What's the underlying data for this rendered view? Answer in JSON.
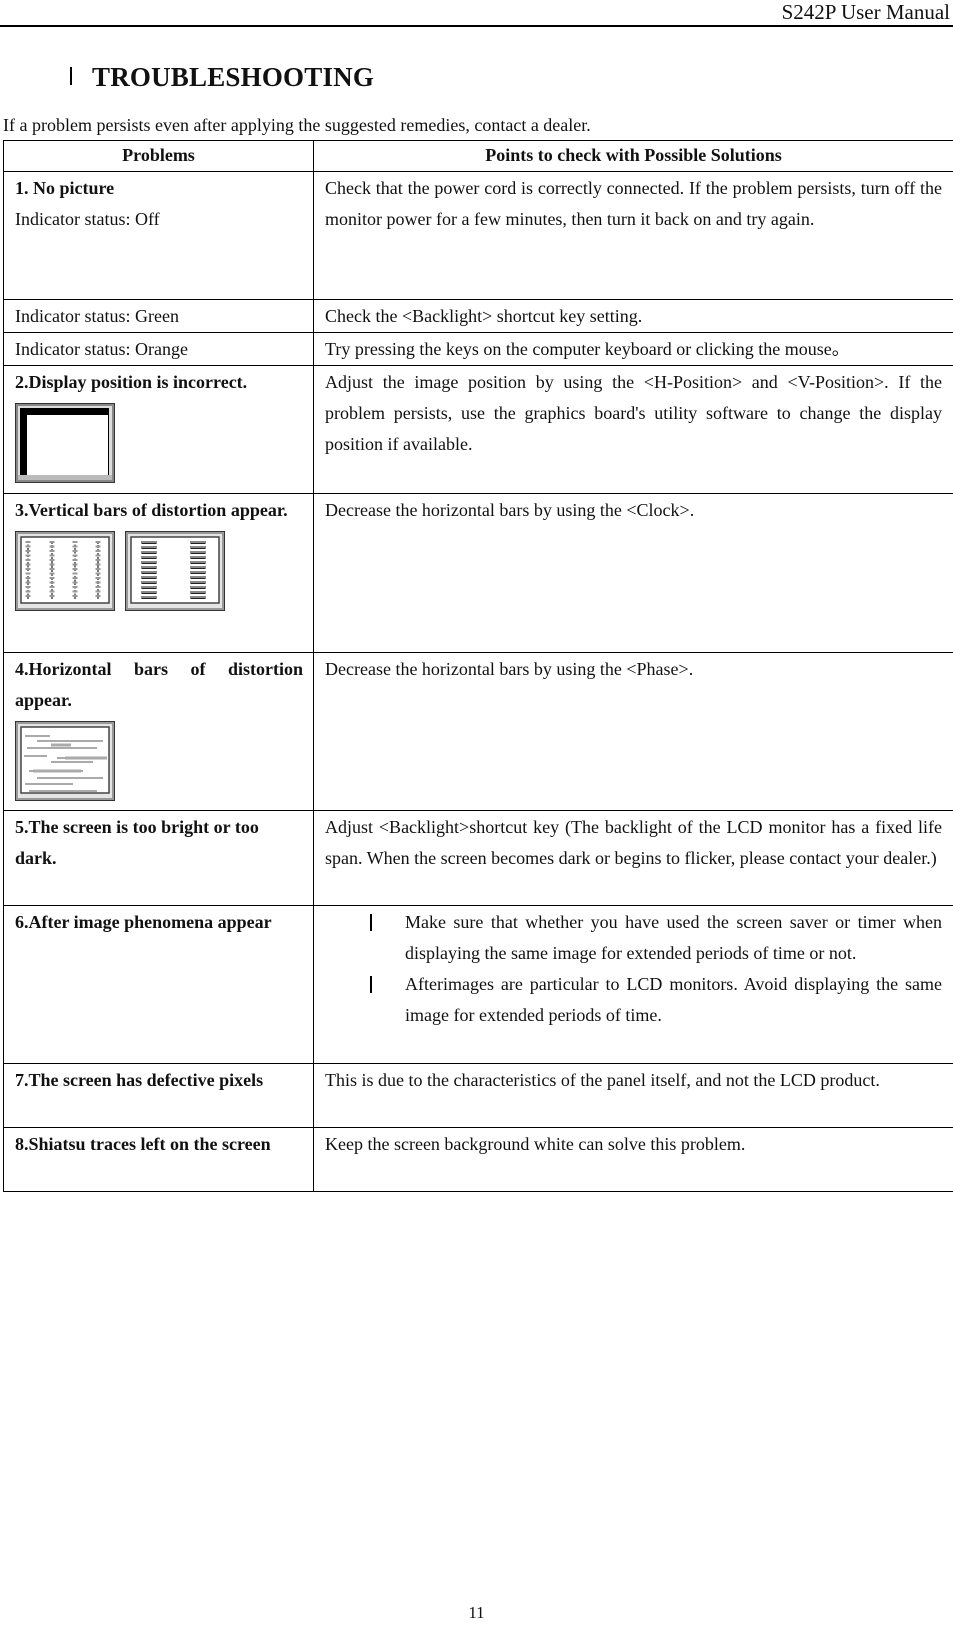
{
  "header": {
    "manual_title": "S242P User Manual"
  },
  "section": {
    "title": "TROUBLESHOOTING"
  },
  "intro": "If a problem persists even after applying the suggested remedies, contact a dealer.",
  "table": {
    "headers": [
      "Problems",
      "Points to check with Possible Solutions"
    ],
    "rows": [
      {
        "problem_title": "1. No picture",
        "problem_detail": "Indicator status: Off",
        "solution": "Check that the power cord is correctly connected. If the problem persists, turn off the monitor power for a few minutes, then turn it back on and try again."
      },
      {
        "problem_detail": "Indicator status: Green",
        "solution": "Check the <Backlight> shortcut key setting."
      },
      {
        "problem_detail": "Indicator status: Orange",
        "solution": "Try pressing the keys on the computer keyboard or clicking the mouse。"
      },
      {
        "problem_title": "2.Display position is incorrect.",
        "icon": "monitor-offset-icon",
        "solution": "Adjust the image position by using the <H-Position> and <V-Position>. If the problem persists, use the graphics board's utility software to change the display position if available."
      },
      {
        "problem_title": "3.Vertical bars of distortion appear.",
        "icons": [
          "monitor-vertical-bars-fine-icon",
          "monitor-vertical-bars-wide-icon"
        ],
        "solution": "Decrease the horizontal bars by using the <Clock>."
      },
      {
        "problem_title": "4.Horizontal bars of distortion appear.",
        "icon": "monitor-horizontal-bars-icon",
        "solution": "Decrease the horizontal bars by using the <Phase>."
      },
      {
        "problem_title": "5.The screen is too bright or too dark.",
        "solution": "Adjust <Backlight>shortcut key (The backlight of the LCD monitor has a fixed life span. When the screen becomes dark or begins to flicker, please contact your dealer.)"
      },
      {
        "problem_title": "6.After image phenomena appear",
        "solution_bullets": [
          "Make sure that whether you have used the screen saver or timer when displaying the same image for extended periods of time or not.",
          "Afterimages are particular to LCD monitors. Avoid displaying the same image for extended periods of time."
        ]
      },
      {
        "problem_title": "7.The screen has defective pixels",
        "solution": "This is due to the characteristics of the panel itself, and not the LCD product."
      },
      {
        "problem_title": "8.Shiatsu traces left on the screen",
        "solution": "Keep the screen background white can solve this problem."
      }
    ]
  },
  "footer": {
    "page_number": "11"
  }
}
